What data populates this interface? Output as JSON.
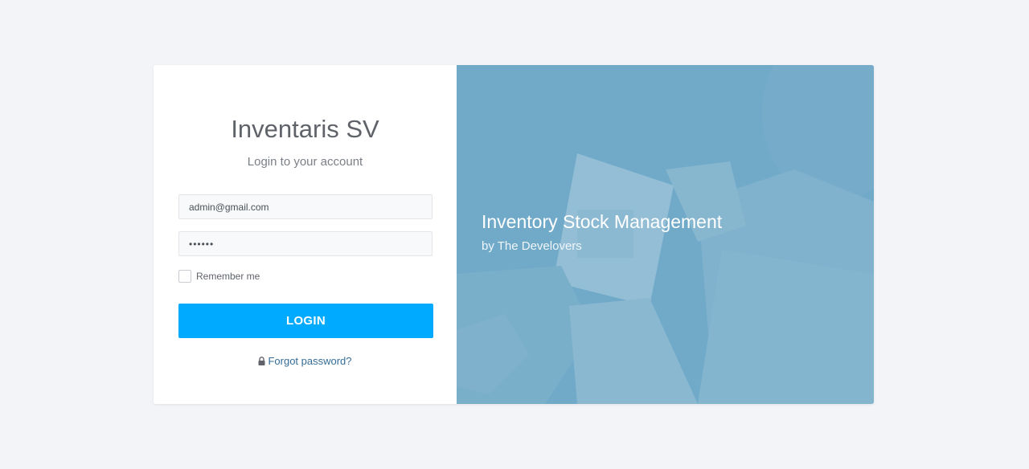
{
  "login": {
    "title": "Inventaris SV",
    "subtitle": "Login to your account",
    "email_value": "admin@gmail.com",
    "password_value": "••••••",
    "remember_label": "Remember me",
    "login_button": "LOGIN",
    "forgot_link": "Forgot password?"
  },
  "hero": {
    "title": "Inventory Stock Management",
    "subtitle": "by The Develovers"
  },
  "colors": {
    "page_bg": "#f2f4f8",
    "accent": "#00aaff",
    "link": "#356c97",
    "hero_overlay": "#6fa7c4"
  },
  "icons": {
    "lock": "lock-icon"
  }
}
